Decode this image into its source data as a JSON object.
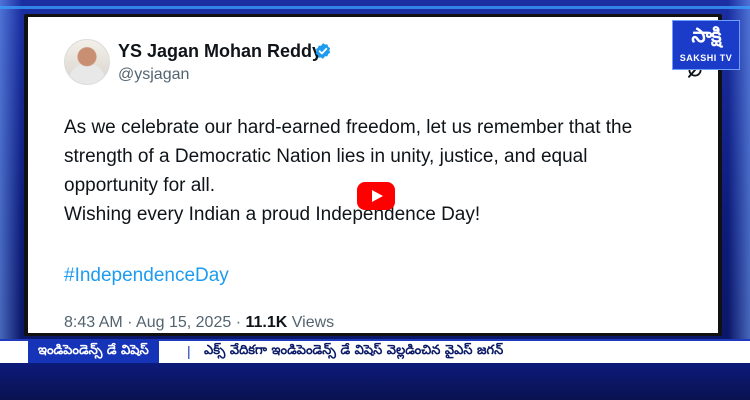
{
  "tweet": {
    "display_name": "YS Jagan Mohan Reddy",
    "handle": "@ysjagan",
    "verified_icon": "verified-badge-icon",
    "lines": [
      "As we celebrate our hard-earned freedom, let us remember that the",
      "strength of a Democratic Nation lies in unity, justice, and equal",
      "opportunity for all.",
      "Wishing every Indian a proud Independence Day!"
    ],
    "hashtag": "#IndependenceDay",
    "time": "8:43 AM",
    "separator": "·",
    "date": "Aug 15, 2025",
    "views_count": "11.1K",
    "views_label": "Views"
  },
  "channel": {
    "logo_text": "సాక్షి",
    "logo_sub": "SAKSHI TV"
  },
  "ticker": {
    "label": "ఇండిపెండెన్స్ డే విషెస్",
    "separator": "|",
    "headline": "ఎక్స్ వేదికగా ఇండిపెండెన్స్ డే విషెస్ వెల్లడించిన వైఎస్ జగన్"
  },
  "colors": {
    "frame_blue": "#1b2fa3",
    "hashtag_blue": "#1d9bf0",
    "play_red": "#ff0000",
    "ticker_label_bg": "#1634b8"
  }
}
